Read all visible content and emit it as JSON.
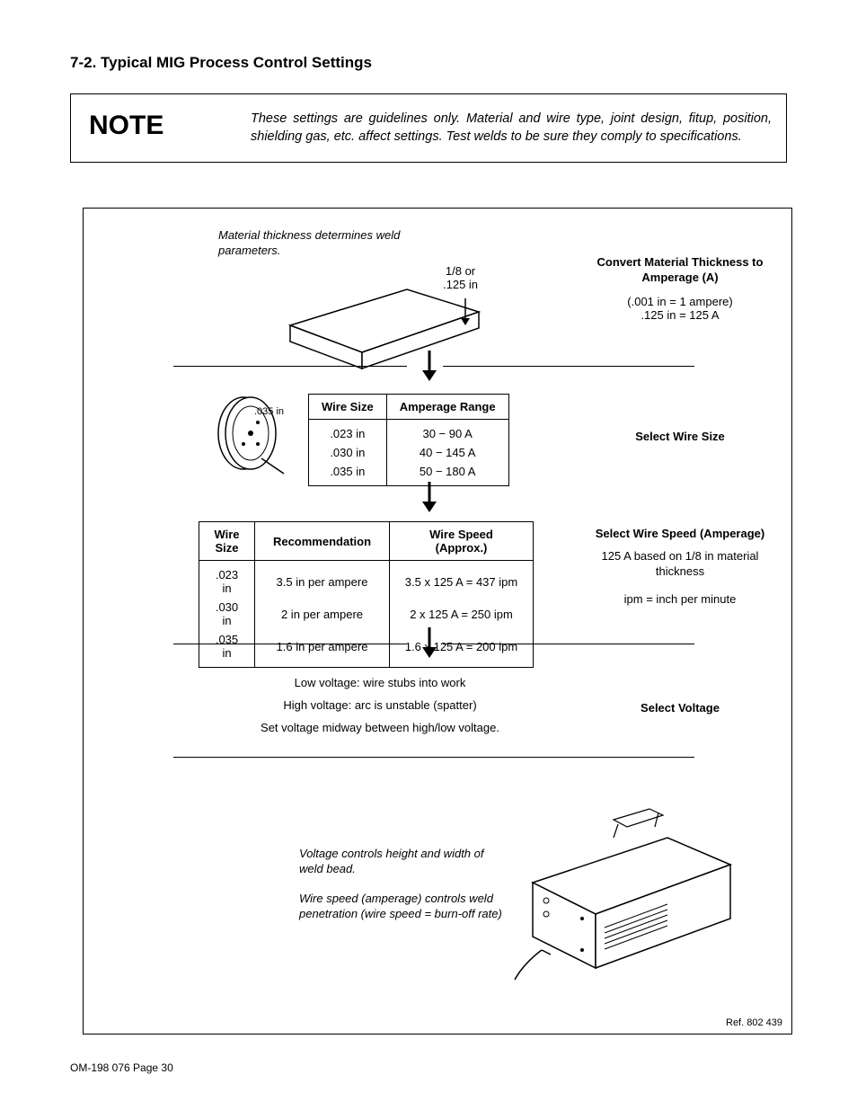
{
  "section_title": "7-2.   Typical MIG Process Control Settings",
  "note": {
    "label": "NOTE",
    "text": "These settings are guidelines only. Material and wire type, joint design, fitup, position, shielding gas, etc. affect settings. Test welds to be sure they comply to specifications."
  },
  "step1": {
    "caption": "Material thickness determines weld parameters.",
    "thickness_label": "1/8 or\n.125 in",
    "side_title": "Convert Material Thickness to Amperage (A)",
    "side_line1": "(.001 in = 1 ampere)",
    "side_line2": ".125 in = 125 A"
  },
  "step2": {
    "spool_label": ".035 in",
    "table": {
      "headers": [
        "Wire Size",
        "Amperage Range"
      ],
      "rows": [
        [
          ".023 in",
          "30 − 90 A"
        ],
        [
          ".030 in",
          "40 − 145 A"
        ],
        [
          ".035 in",
          "50 − 180 A"
        ]
      ]
    },
    "side_title": "Select Wire Size"
  },
  "step3": {
    "table": {
      "headers": [
        "Wire Size",
        "Recommendation",
        "Wire Speed (Approx.)"
      ],
      "rows": [
        [
          ".023 in",
          "3.5 in per ampere",
          "3.5 x 125 A = 437 ipm"
        ],
        [
          ".030 in",
          "2 in per ampere",
          "2 x 125 A = 250 ipm"
        ],
        [
          ".035 in",
          "1.6 in per ampere",
          "1.6 x 125 A = 200 ipm"
        ]
      ]
    },
    "side_title": "Select Wire Speed (Amperage)",
    "side_line1": "125 A based on 1/8 in material thickness",
    "side_line2": "ipm = inch per minute"
  },
  "step4": {
    "lines": [
      "Low voltage: wire stubs into work",
      "High voltage: arc is unstable (spatter)",
      "Set voltage midway between high/low voltage."
    ],
    "side_title": "Select Voltage"
  },
  "step5": {
    "caption1": "Voltage controls height and width of weld bead.",
    "caption2": "Wire speed (amperage) controls weld penetration (wire speed = burn-off rate)"
  },
  "ref": "Ref. 802 439",
  "footer": "OM-198 076 Page 30"
}
